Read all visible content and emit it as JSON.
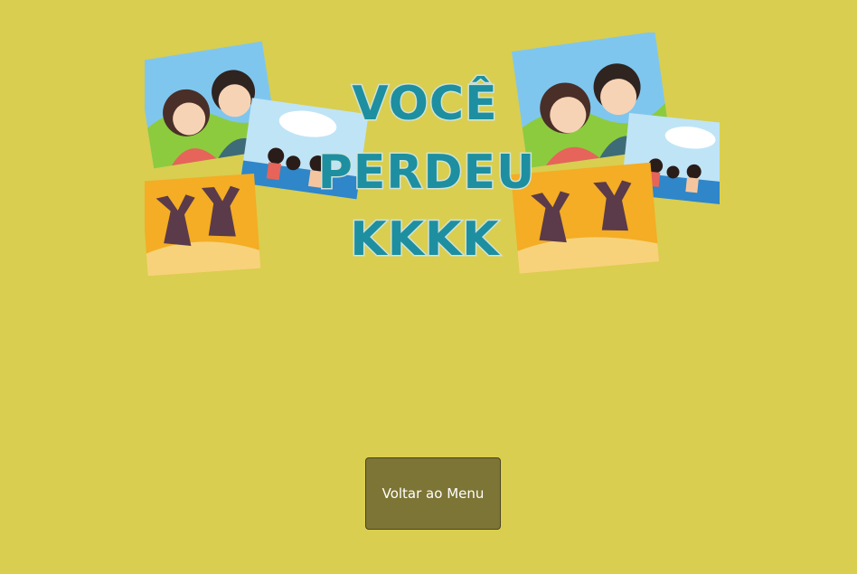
{
  "banner": {
    "title_line_1": "VOCÊ",
    "title_line_2": "PERDEU",
    "title_line_3": "KKKK",
    "title_color": "#1d8fa0"
  },
  "menu_button": {
    "label": "Voltar ao Menu"
  },
  "colors": {
    "background": "#d9ce4f",
    "button": "#7d7535"
  }
}
